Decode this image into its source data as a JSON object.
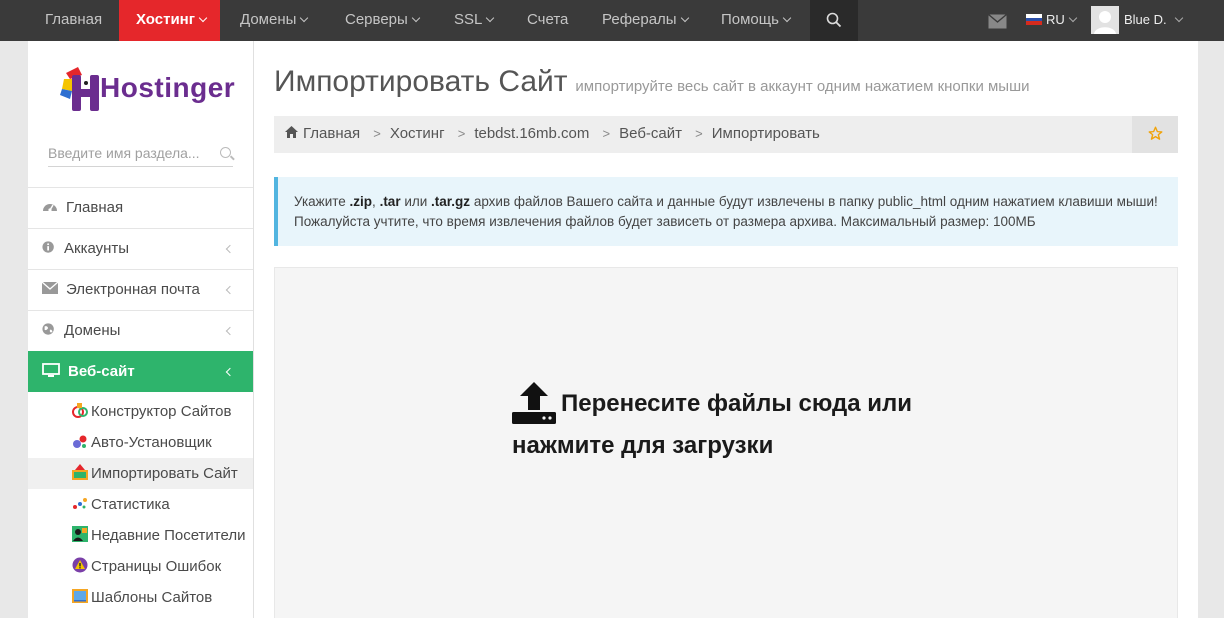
{
  "topnav": {
    "items": [
      {
        "label": "Главная"
      },
      {
        "label": "Хостинг"
      },
      {
        "label": "Домены"
      },
      {
        "label": "Серверы"
      },
      {
        "label": "SSL"
      },
      {
        "label": "Счета"
      },
      {
        "label": "Рефералы"
      },
      {
        "label": "Помощь"
      }
    ],
    "lang": "RU",
    "user": "Blue D."
  },
  "sidebar": {
    "logo_text": "Hostinger",
    "search_placeholder": "Введите имя раздела...",
    "menu": [
      {
        "label": "Главная"
      },
      {
        "label": "Аккаунты"
      },
      {
        "label": "Электронная почта"
      },
      {
        "label": "Домены"
      },
      {
        "label": "Веб-сайт"
      }
    ],
    "submenu": [
      {
        "label": "Конструктор Сайтов"
      },
      {
        "label": "Авто-Установщик"
      },
      {
        "label": "Импортировать Сайт"
      },
      {
        "label": "Статистика"
      },
      {
        "label": "Недавние Посетители"
      },
      {
        "label": "Страницы Ошибок"
      },
      {
        "label": "Шаблоны Сайтов"
      }
    ]
  },
  "page": {
    "title": "Импортировать Сайт",
    "subtitle": "импортируйте весь сайт в аккаунт одним нажатием кнопки мыши",
    "breadcrumbs": [
      "Главная",
      "Хостинг",
      "tebdst.16mb.com",
      "Веб-сайт",
      "Импортировать"
    ],
    "alert": {
      "t1": "Укажите ",
      "zip": ".zip",
      "t2": ", ",
      "tar": ".tar",
      "t3": " или ",
      "targz": ".tar.gz",
      "t4": " архив файлов Вашего сайта и данные будут извлечены в папку public_html одним нажатием клавиши мыши! Пожалуйста учтите, что время извлечения файлов будет зависеть от размера архива. Максимальный размер: 100МБ"
    },
    "dropzone_text": "Перенесите файлы сюда или нажмите для загрузки"
  }
}
